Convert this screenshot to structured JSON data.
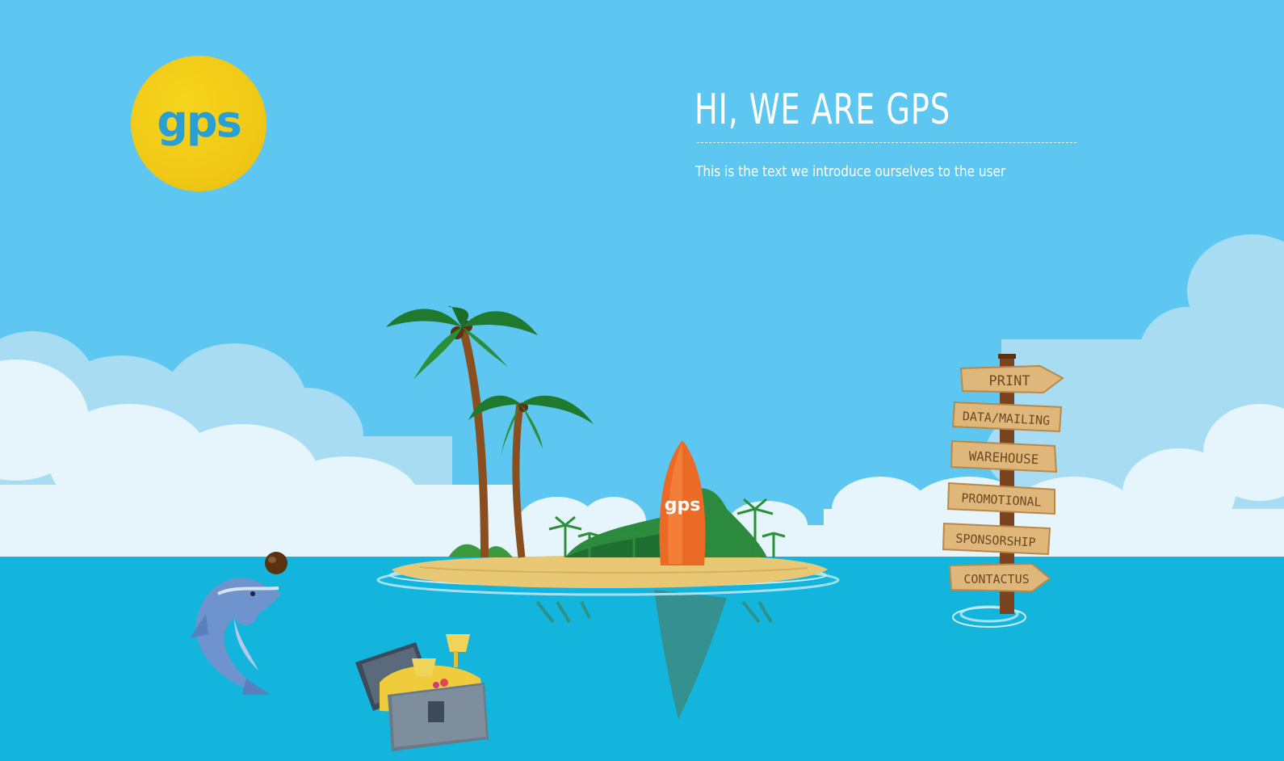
{
  "logo": {
    "text": "gps"
  },
  "hero": {
    "title": "HI, WE ARE GPS",
    "intro": "This is the text we introduce ourselves to the user"
  },
  "surfboard": {
    "text": "gps"
  },
  "signpost": {
    "items": [
      {
        "label": "PRINT"
      },
      {
        "label": "DATA/MAILING"
      },
      {
        "label": "WAREHOUSE"
      },
      {
        "label": "PROMOTIONAL"
      },
      {
        "label": "SPONSORSHIP"
      },
      {
        "label": "CONTACTUS"
      }
    ]
  },
  "colors": {
    "sky": "#5dc6f1",
    "sea": "#14b5dc",
    "logo_yellow": "#f2cc18",
    "logo_blue": "#2a9fd4",
    "surfboard": "#ea6a26",
    "wood": "#e0b77a"
  }
}
